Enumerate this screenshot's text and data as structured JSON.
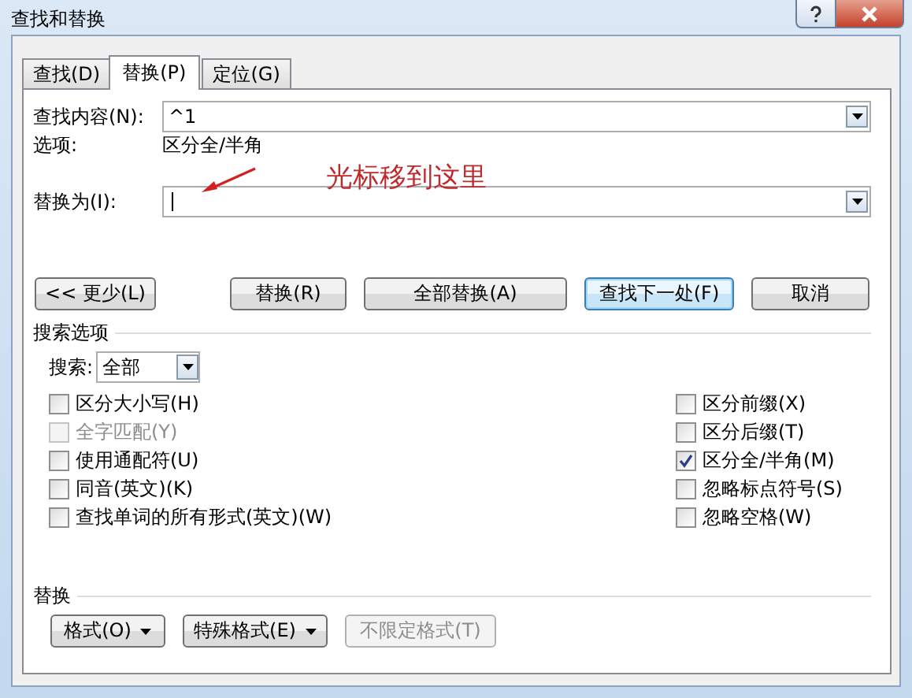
{
  "window": {
    "title": "查找和替换"
  },
  "tabs": [
    {
      "label": "查找(D)",
      "selected": false
    },
    {
      "label": "替换(P)",
      "selected": true
    },
    {
      "label": "定位(G)",
      "selected": false
    }
  ],
  "find": {
    "label": "查找内容(N):",
    "value": "^1"
  },
  "options": {
    "label": "选项:",
    "value": "区分全/半角"
  },
  "replace": {
    "label": "替换为(I):"
  },
  "annotation": {
    "text": "光标移到这里"
  },
  "buttons": [
    {
      "label": "<< 更少(L)",
      "focused": false
    },
    {
      "label": "替换(R)",
      "focused": false
    },
    {
      "label": "全部替换(A)",
      "focused": false
    },
    {
      "label": "查找下一处(F)",
      "focused": true
    },
    {
      "label": "取消",
      "focused": false
    }
  ],
  "search_options": {
    "title": "搜索选项",
    "search_label": "搜索:",
    "search_value": "全部",
    "left_checks": [
      {
        "label": "区分大小写(H)",
        "checked": false,
        "disabled": false
      },
      {
        "label": "全字匹配(Y)",
        "checked": false,
        "disabled": true
      },
      {
        "label": "使用通配符(U)",
        "checked": false,
        "disabled": false
      },
      {
        "label": "同音(英文)(K)",
        "checked": false,
        "disabled": false
      },
      {
        "label": "查找单词的所有形式(英文)(W)",
        "checked": false,
        "disabled": false
      }
    ],
    "right_checks": [
      {
        "label": "区分前缀(X)",
        "checked": false,
        "disabled": false
      },
      {
        "label": "区分后缀(T)",
        "checked": false,
        "disabled": false
      },
      {
        "label": "区分全/半角(M)",
        "checked": true,
        "disabled": false
      },
      {
        "label": "忽略标点符号(S)",
        "checked": false,
        "disabled": false
      },
      {
        "label": "忽略空格(W)",
        "checked": false,
        "disabled": false
      }
    ]
  },
  "replace_section": {
    "title": "替换",
    "buttons": [
      {
        "label": "格式(O)",
        "dropdown": true,
        "disabled": false
      },
      {
        "label": "特殊格式(E)",
        "dropdown": true,
        "disabled": false
      },
      {
        "label": "不限定格式(T)",
        "dropdown": false,
        "disabled": true
      }
    ]
  }
}
